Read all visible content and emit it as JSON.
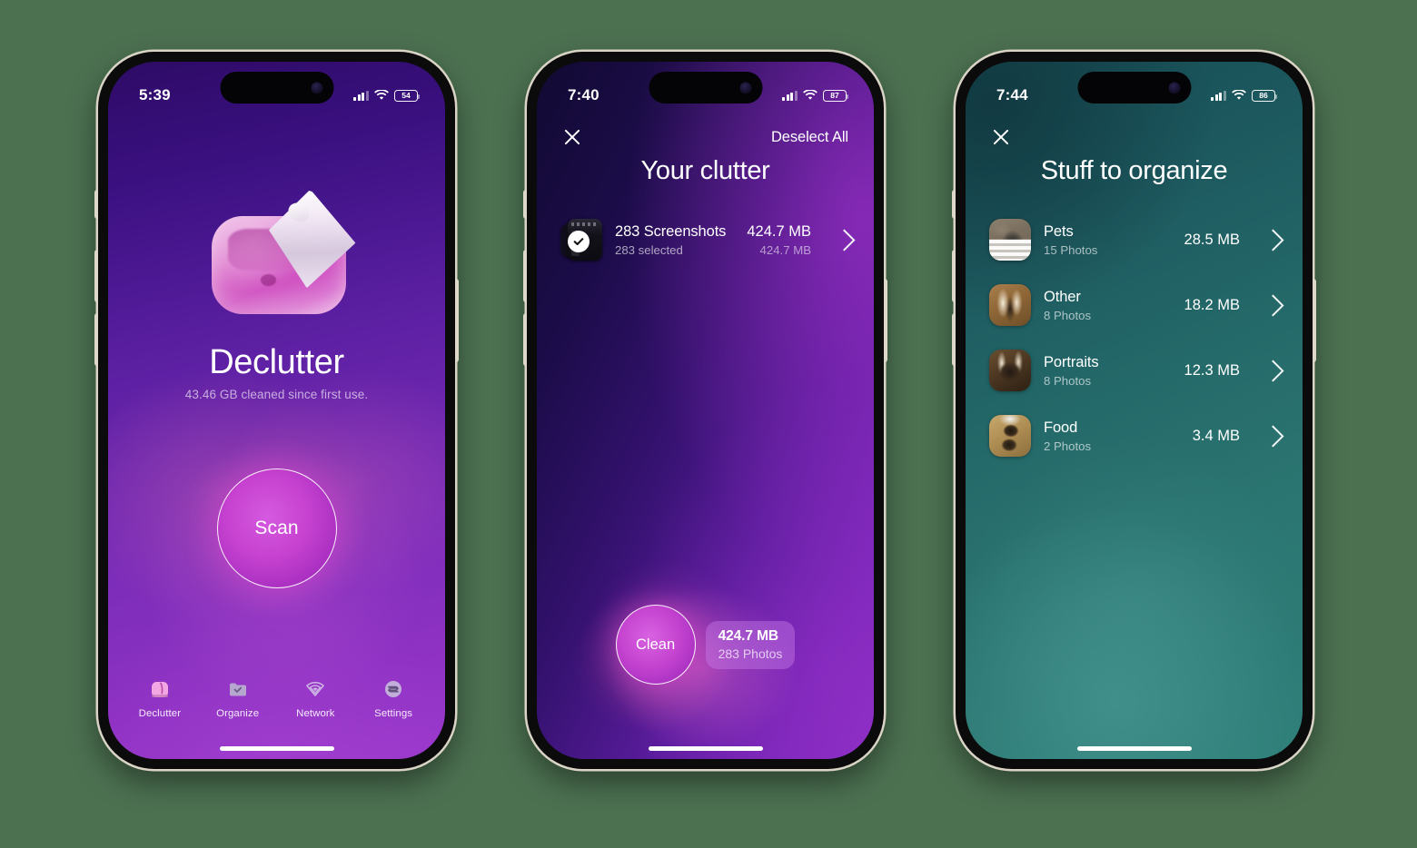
{
  "background_color": "#4c7151",
  "phone1": {
    "status": {
      "time": "5:39",
      "battery": "54",
      "signal_icon": "cellular-bars-icon",
      "wifi_icon": "wifi-icon"
    },
    "hero_icon": "trash-bin-icon",
    "title": "Declutter",
    "subtitle": "43.46 GB cleaned since first use.",
    "scan_button": "Scan",
    "tabs": [
      {
        "label": "Declutter",
        "icon": "declutter-bin-icon",
        "active": true
      },
      {
        "label": "Organize",
        "icon": "folder-check-icon",
        "active": false
      },
      {
        "label": "Network",
        "icon": "wifi-signal-icon",
        "active": false
      },
      {
        "label": "Settings",
        "icon": "settings-sliders-icon",
        "active": false
      }
    ]
  },
  "phone2": {
    "status": {
      "time": "7:40",
      "battery": "87",
      "signal_icon": "cellular-bars-icon",
      "wifi_icon": "wifi-icon"
    },
    "close_icon": "close-x-icon",
    "nav_action": "Deselect All",
    "title": "Your clutter",
    "rows": [
      {
        "thumbnail": "screenshot-stack-thumbnail",
        "checked_icon": "check-circle-icon",
        "title": "283 Screenshots",
        "subtitle": "283 selected",
        "size": "424.7 MB",
        "size_sub": "424.7 MB",
        "chevron": "chevron-right-icon"
      }
    ],
    "clean_button": "Clean",
    "clean_info": {
      "size": "424.7 MB",
      "count": "283 Photos"
    }
  },
  "phone3": {
    "status": {
      "time": "7:44",
      "battery": "86",
      "signal_icon": "cellular-bars-icon",
      "wifi_icon": "wifi-icon"
    },
    "close_icon": "close-x-icon",
    "title": "Stuff to organize",
    "rows": [
      {
        "thumbnail": "pets-photo-thumbnail",
        "title": "Pets",
        "subtitle": "15 Photos",
        "size": "28.5 MB",
        "chevron": "chevron-right-icon"
      },
      {
        "thumbnail": "other-photo-thumbnail",
        "title": "Other",
        "subtitle": "8 Photos",
        "size": "18.2 MB",
        "chevron": "chevron-right-icon"
      },
      {
        "thumbnail": "portraits-photo-thumbnail",
        "title": "Portraits",
        "subtitle": "8 Photos",
        "size": "12.3 MB",
        "chevron": "chevron-right-icon"
      },
      {
        "thumbnail": "food-photo-thumbnail",
        "title": "Food",
        "subtitle": "2 Photos",
        "size": "3.4 MB",
        "chevron": "chevron-right-icon"
      }
    ]
  }
}
